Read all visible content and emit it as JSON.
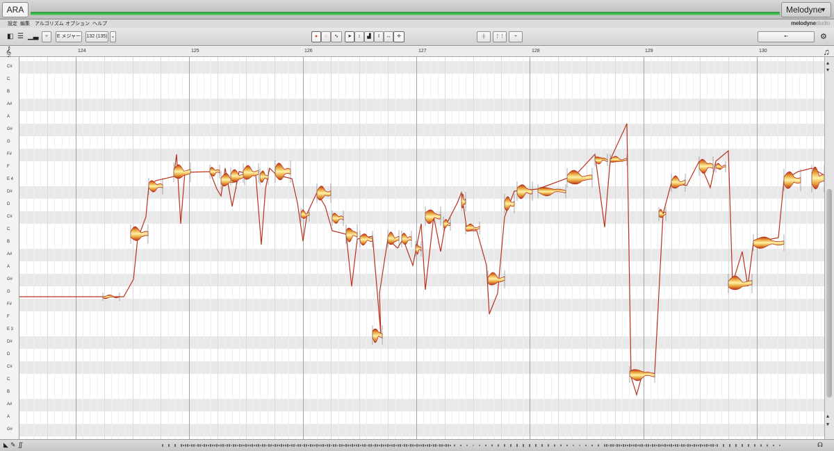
{
  "app": {
    "tab_label": "ARA",
    "product_menu": "Melodyne",
    "brand": "melodyne",
    "brand_edition": "studio"
  },
  "menu": [
    {
      "label": "設定"
    },
    {
      "label": "編集"
    },
    {
      "label": "アルゴリズム"
    },
    {
      "label": "オプション"
    },
    {
      "label": "ヘルプ"
    }
  ],
  "toolbar": {
    "scale_label": "E メジャー",
    "tempo_label": "132 (135)",
    "dropdown_caret": "⌄"
  },
  "ruler": {
    "bars": [
      "124",
      "125",
      "126",
      "127",
      "128",
      "129",
      "130"
    ]
  },
  "pitches": [
    "C#",
    "C",
    "B",
    "A#",
    "A",
    "G#",
    "G",
    "F#",
    "F",
    "E 4",
    "D#",
    "D",
    "C#",
    "C",
    "B",
    "A#",
    "A",
    "G#",
    "G",
    "F#",
    "F",
    "E 3",
    "D#",
    "D",
    "C#",
    "C",
    "B",
    "A#",
    "A",
    "G#"
  ],
  "colors": {
    "blob_outer": "#b8321c",
    "blob_mid": "#e8a33a",
    "blob_inner": "#fff3a8",
    "track_green": "#3cb54a"
  },
  "icons": {
    "clef": "treble-clef-icon",
    "note": "music-note-icon",
    "settings": "gear-icon"
  }
}
